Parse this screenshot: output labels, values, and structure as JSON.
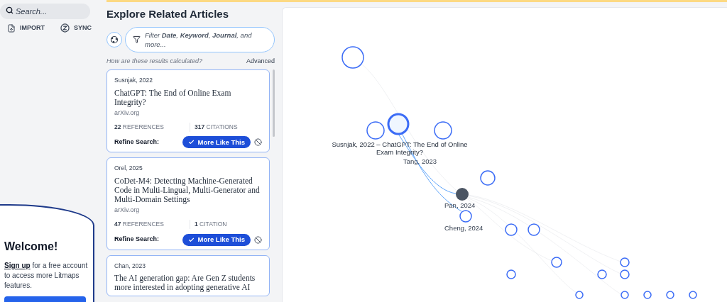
{
  "sidebar": {
    "search": {
      "placeholder": "Search..."
    },
    "actions": [
      {
        "label": "IMPORT",
        "kind": "import"
      },
      {
        "label": "SYNC",
        "kind": "sync"
      }
    ],
    "welcome": {
      "title": "Welcome!",
      "link": "Sign up",
      "text": "for a free account to access more Litmaps features."
    }
  },
  "related": {
    "title": "Explore Related Articles",
    "filter_prompt": "Filter **Date**, **Keyword**, **Journal**, and more...",
    "help_link": "How are these results calculated?",
    "advanced": "Advanced",
    "articles": [
      {
        "author": "Susnjak, 2022",
        "title": "ChatGPT: The End of Online Exam Integrity?",
        "source": "arXiv.org",
        "references_count": "22",
        "references_label": "REFERENCES",
        "citations_count": "317",
        "citations_label": "CITATIONS",
        "refine_label": "Refine Search:",
        "action": "More Like This"
      },
      {
        "author": "Orel, 2025",
        "title": "CoDet-M4: Detecting Machine-Generated Code in Multi-Lingual, Multi-Generator and Multi-Domain Settings",
        "source": "arXiv.org",
        "references_count": "47",
        "references_label": "REFERENCES",
        "citations_count": "1",
        "citations_label": "CITATION",
        "refine_label": "Refine Search:",
        "action": "More Like This"
      },
      {
        "author": "Chan, 2023",
        "title": "The AI generation gap: Are Gen Z students more interested in adopting generative AI"
      }
    ]
  },
  "graph": {
    "labels": [
      {
        "text": "Susnjak, 2022 – ChatGPT: The End of Online Exam Integrity?",
        "kind": "selected"
      },
      {
        "text": "Tang, 2023",
        "kind": "plain"
      },
      {
        "text": "Pan, 2024",
        "kind": "plain"
      },
      {
        "text": "Cheng, 2024",
        "kind": "plain"
      }
    ]
  }
}
